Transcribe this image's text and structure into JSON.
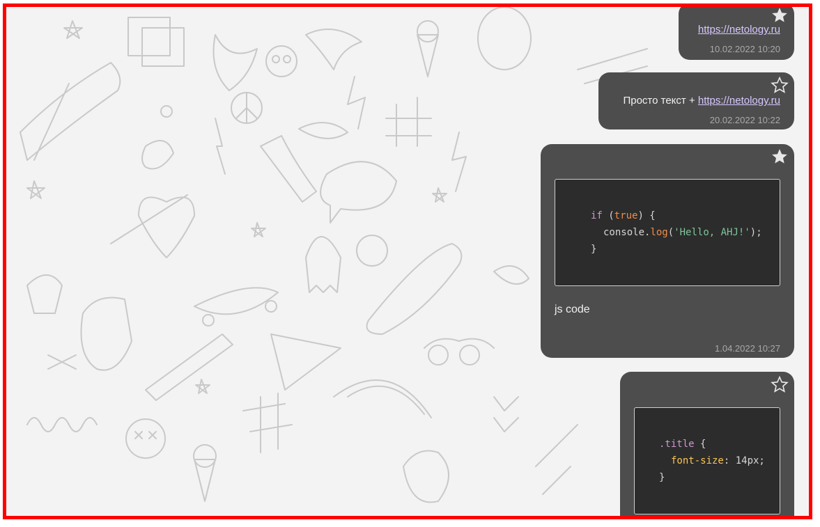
{
  "messages": [
    {
      "starred": true,
      "text_prefix": "",
      "link": "https://netology.ru",
      "time": "10.02.2022 10:20"
    },
    {
      "starred": false,
      "text_prefix": "Просто текст + ",
      "link": "https://netology.ru",
      "time": "20.02.2022 10:22"
    },
    {
      "starred": true,
      "code": {
        "kw_if": "if",
        "lit_true": "true",
        "obj": "console",
        "fn": "log",
        "str": "'Hello, AHJ!'",
        "close": "}"
      },
      "caption": "js code",
      "time": "1.04.2022 10:27"
    },
    {
      "starred": false,
      "code": {
        "selector": ".title",
        "property": "font-size",
        "value": "14px;",
        "close": "}"
      }
    }
  ],
  "icons": {
    "star_filled": "star-filled-icon",
    "star_outline": "star-outline-icon"
  },
  "colors": {
    "bubble": "#4d4d4d",
    "frame": "#ff0000",
    "link": "#d7c8ff",
    "code_bg": "#2c2c2c"
  }
}
